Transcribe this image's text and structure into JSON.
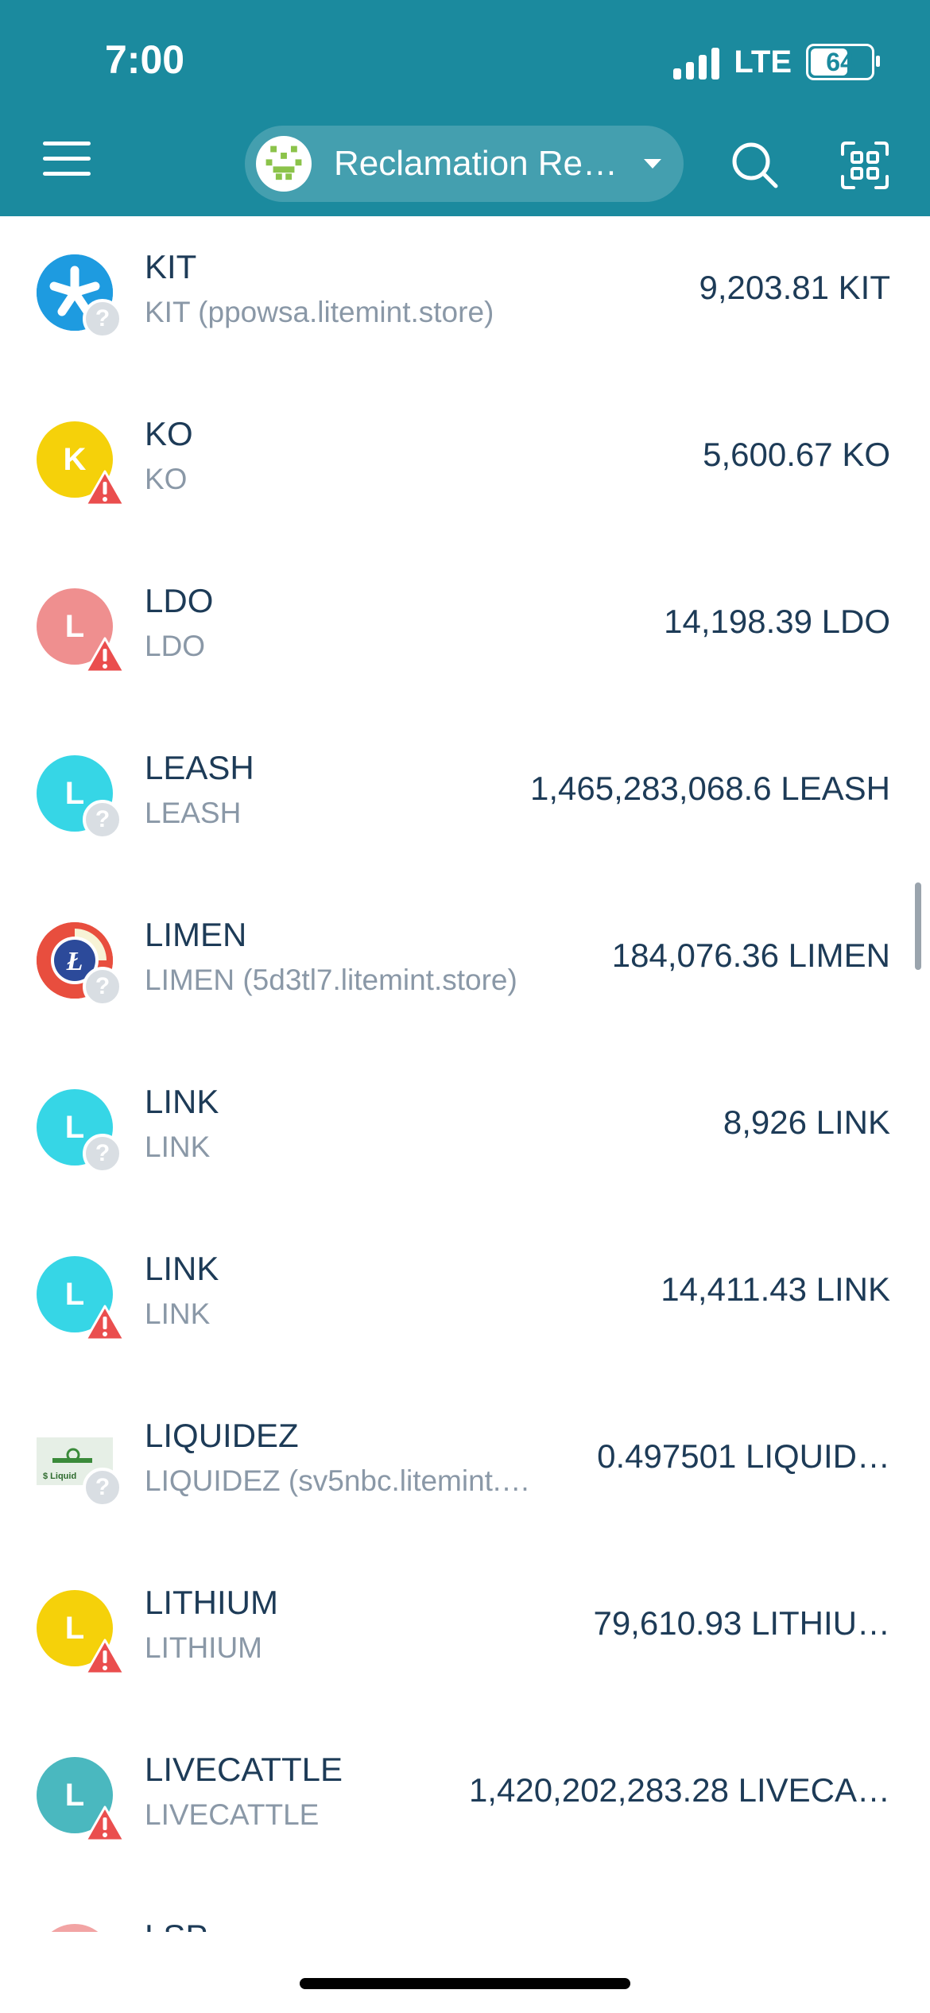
{
  "status_bar": {
    "time": "7:00",
    "network": "LTE",
    "battery": "64"
  },
  "header": {
    "account_name": "Reclamation Re…"
  },
  "colors": {
    "header": "#1b8a9e",
    "warning": "#ea4e4e",
    "unverified": "#d9dee3"
  },
  "tokens": [
    {
      "name": "KIT",
      "sub": "KIT (ppowsa.litemint.store)",
      "amount": "9,203.81 KIT",
      "letter": "",
      "icon": "kit-logo-icon",
      "color": "#1e9be0",
      "badge": "unknown"
    },
    {
      "name": "KO",
      "sub": "KO",
      "amount": "5,600.67 KO",
      "letter": "K",
      "color": "#f5d10a",
      "badge": "warning"
    },
    {
      "name": "LDO",
      "sub": "LDO",
      "amount": "14,198.39 LDO",
      "letter": "L",
      "color": "#ef8f8f",
      "badge": "warning"
    },
    {
      "name": "LEASH",
      "sub": "LEASH",
      "amount": "1,465,283,068.6 LEASH",
      "letter": "L",
      "color": "#36d6e6",
      "badge": "unknown"
    },
    {
      "name": "LIMEN",
      "sub": "LIMEN (5d3tl7.litemint.store)",
      "amount": "184,076.36 LIMEN",
      "letter": "",
      "icon": "litecoin-logo-icon",
      "color": "#e84e3e",
      "badge": "unknown"
    },
    {
      "name": "LINK",
      "sub": "LINK",
      "amount": "8,926 LINK",
      "letter": "L",
      "color": "#36d6e6",
      "badge": "unknown"
    },
    {
      "name": "LINK",
      "sub": "LINK",
      "amount": "14,411.43 LINK",
      "letter": "L",
      "color": "#36d6e6",
      "badge": "warning"
    },
    {
      "name": "LIQUIDEZ",
      "sub": "LIQUIDEZ (sv5nbc.litemint.…",
      "amount": "0.497501 LIQUID…",
      "letter": "",
      "icon": "liquidez-logo-icon",
      "color": "#e6efe6",
      "badge": "unknown"
    },
    {
      "name": "LITHIUM",
      "sub": "LITHIUM",
      "amount": "79,610.93 LITHIU…",
      "letter": "L",
      "color": "#f5d10a",
      "badge": "warning"
    },
    {
      "name": "LIVECATTLE",
      "sub": "LIVECATTLE",
      "amount": "1,420,202,283.28 LIVECA…",
      "letter": "L",
      "color": "#4ab8bf",
      "badge": "warning"
    },
    {
      "name": "LSP",
      "sub": "",
      "amount": "",
      "letter": "",
      "color": "#f2a4a4",
      "badge": ""
    }
  ]
}
